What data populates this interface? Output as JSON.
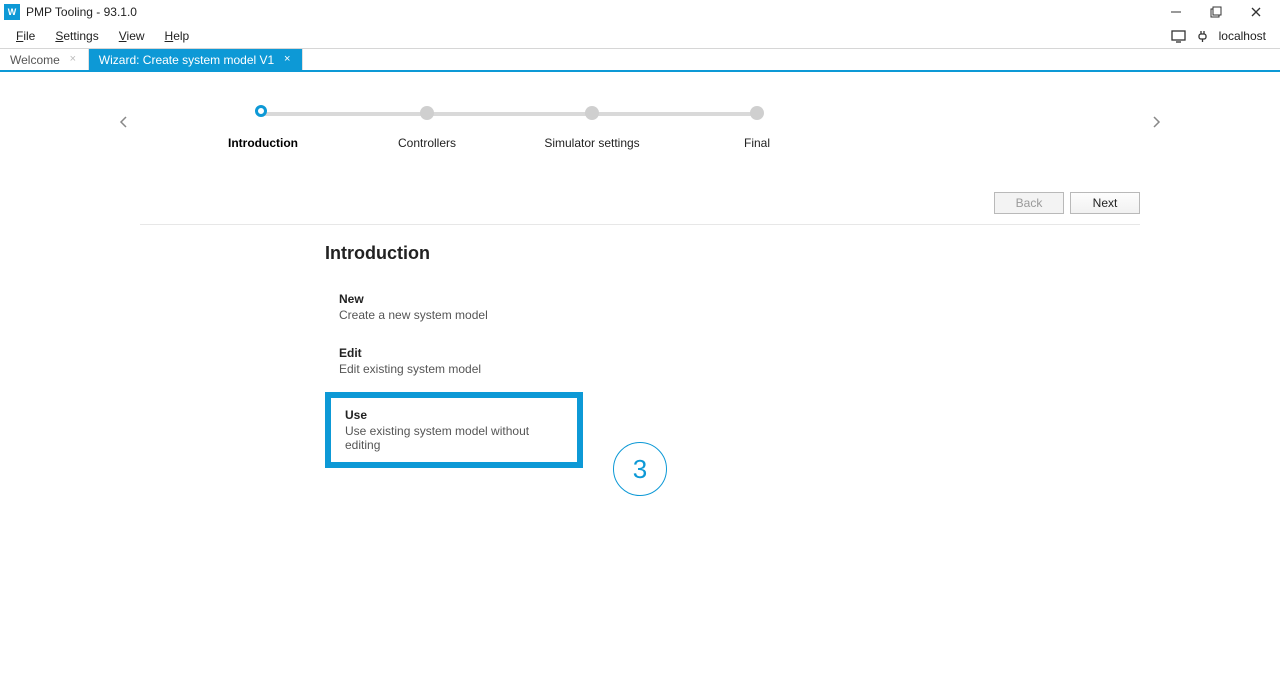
{
  "window": {
    "title": "PMP Tooling - 93.1.0"
  },
  "menu": {
    "file": "File",
    "settings": "Settings",
    "view": "View",
    "help": "Help"
  },
  "status": {
    "host": "localhost"
  },
  "tabs": {
    "welcome": "Welcome",
    "wizard": "Wizard: Create system model V1"
  },
  "stepper": {
    "step1": "Introduction",
    "step2": "Controllers",
    "step3": "Simulator settings",
    "step4": "Final"
  },
  "buttons": {
    "back": "Back",
    "next": "Next"
  },
  "intro": {
    "heading": "Introduction",
    "new_title": "New",
    "new_desc": "Create a new system model",
    "edit_title": "Edit",
    "edit_desc": "Edit existing system model",
    "use_title": "Use",
    "use_desc": "Use existing system model without editing"
  },
  "callout": {
    "number": "3"
  }
}
